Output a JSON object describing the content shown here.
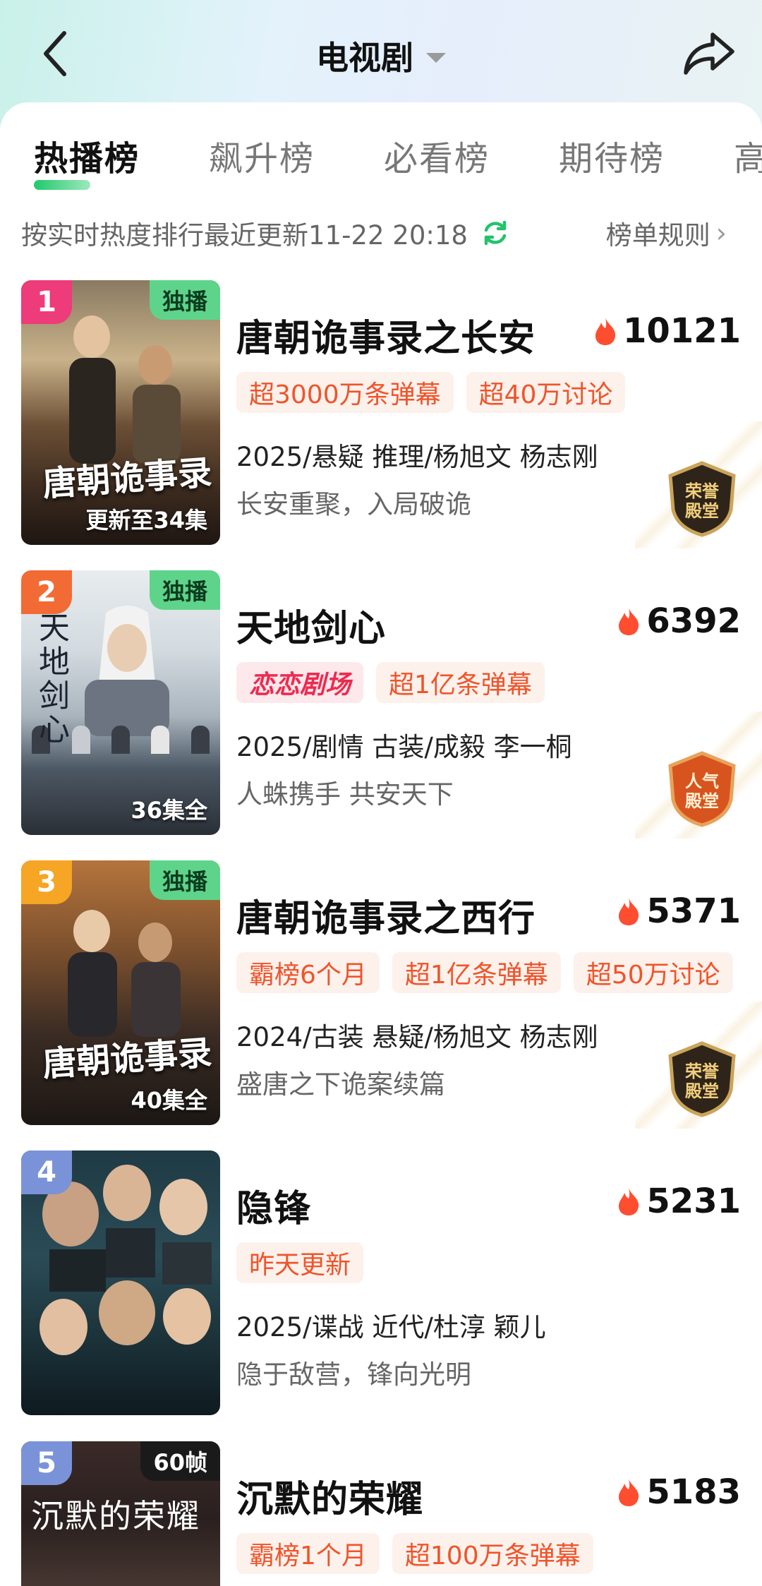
{
  "header": {
    "title": "电视剧"
  },
  "tabs": [
    {
      "label": "热播榜",
      "active": true
    },
    {
      "label": "飙升榜",
      "active": false
    },
    {
      "label": "必看榜",
      "active": false
    },
    {
      "label": "期待榜",
      "active": false
    },
    {
      "label": "高",
      "active": false
    }
  ],
  "subline": {
    "text": "按实时热度排行最近更新11-22 20:18",
    "rule_label": "榜单规则"
  },
  "colors": {
    "accent_green": "#21c96b",
    "tag_text": "#f0542a",
    "tag_bg": "#fdf1ec",
    "rank1": "#ee3b79",
    "rank2": "#f26b35",
    "rank3": "#f6a525",
    "rank4_5": "#7a93d8"
  },
  "items": [
    {
      "rank": "1",
      "corner": "独播",
      "caption": "更新至34集",
      "poster_title": "唐朝诡事录",
      "title": "唐朝诡事录之长安",
      "heat": "10121",
      "tags": [
        "超3000万条弹幕",
        "超40万讨论"
      ],
      "meta": "2025/悬疑 推理/杨旭文 杨志刚",
      "desc": "长安重聚，入局破诡",
      "badge": [
        "荣誉",
        "殿堂"
      ]
    },
    {
      "rank": "2",
      "corner": "独播",
      "caption": "36集全",
      "poster_title": "天地剑心",
      "title": "天地剑心",
      "heat": "6392",
      "logo_tag": "恋恋剧场",
      "tags": [
        "超1亿条弹幕"
      ],
      "meta": "2025/剧情 古装/成毅 李一桐",
      "desc": "人蛛携手 共安天下",
      "badge": [
        "人气",
        "殿堂"
      ]
    },
    {
      "rank": "3",
      "corner": "独播",
      "caption": "40集全",
      "poster_title": "唐朝诡事录",
      "title": "唐朝诡事录之西行",
      "heat": "5371",
      "tags": [
        "霸榜6个月",
        "超1亿条弹幕",
        "超50万讨论"
      ],
      "meta": "2024/古装 悬疑/杨旭文 杨志刚",
      "desc": "盛唐之下诡案续篇",
      "badge": [
        "荣誉",
        "殿堂"
      ]
    },
    {
      "rank": "4",
      "title": "隐锋",
      "heat": "5231",
      "tags": [
        "昨天更新"
      ],
      "meta": "2025/谍战 近代/杜淳 颖儿",
      "desc": "隐于敌营，锋向光明"
    },
    {
      "rank": "5",
      "corner": "60帧",
      "poster_title": "沉默的荣耀",
      "title": "沉默的荣耀",
      "heat": "5183",
      "tags": [
        "霸榜1个月",
        "超100万条弹幕"
      ]
    }
  ]
}
